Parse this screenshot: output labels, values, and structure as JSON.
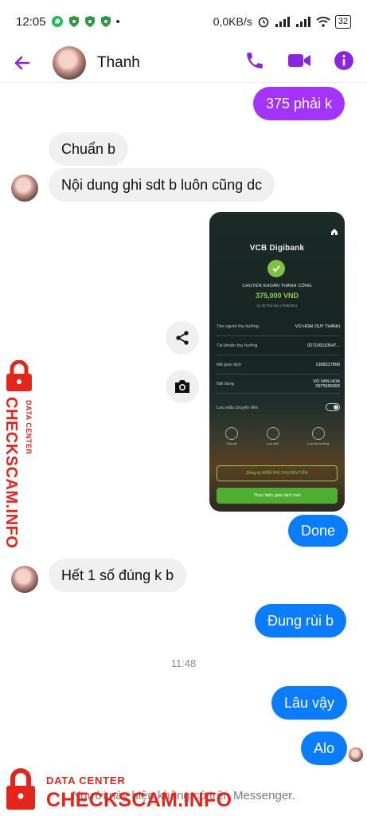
{
  "status_bar": {
    "time": "12:05",
    "net_speed": "0,0KB/s",
    "battery": "32"
  },
  "header": {
    "contact_name": "Thanh"
  },
  "messages": [
    {
      "from": "me",
      "text": "375 phải k"
    },
    {
      "from": "them",
      "text": "Chuẩn b"
    },
    {
      "from": "them",
      "text": "Nội dung ghi sdt b luôn cũng dc"
    },
    {
      "from": "me",
      "text": "Done"
    },
    {
      "from": "them",
      "text": "Hết 1 số đúng k b"
    },
    {
      "from": "me",
      "text": "Đung rùi b"
    },
    {
      "from": "me",
      "text": "Lâu vậy"
    },
    {
      "from": "me",
      "text": "Alo"
    }
  ],
  "time_separator": "11:48",
  "receipt": {
    "brand": "VCB Digibank",
    "status": "CHUYỂN KHOẢN THÀNH CÔNG",
    "amount": "375,000 VND",
    "datetime": "11:30 Thứ Ba 17/08/2021",
    "rows": [
      {
        "label": "Tên người thụ hưởng",
        "value": "VO HOAI DUY THANH"
      },
      {
        "label": "Tài khoản thụ hưởng",
        "value": "027100110547..."
      },
      {
        "label": "Mã giao dịch",
        "value": "1308317890"
      },
      {
        "label": "Nội dung",
        "value": "VO VAN HOA 0975556993"
      },
      {
        "label": "Lưu mẫu chuyển tiền",
        "value": ""
      }
    ],
    "icons": [
      {
        "name": "share",
        "label": "Chia sẻ"
      },
      {
        "name": "camera",
        "label": "Lưu ảnh"
      },
      {
        "name": "contact",
        "label": "Lưu thụ hưởng"
      }
    ],
    "btn_register": "Đăng ký MIỄN PHÍ CHUYỂN TIỀN",
    "btn_new": "Thực hiện giao dịch mới"
  },
  "watermark": {
    "line_small": "DATA CENTER",
    "line_big": "CHECKSCAM.INFO"
  },
  "footer_note": "Người này hiện không có trên Messenger.",
  "colors": {
    "accent": "#a533ff",
    "outgoing": "#0a7cff",
    "incoming": "#f0f0f0",
    "watermark": "#e3251b"
  }
}
